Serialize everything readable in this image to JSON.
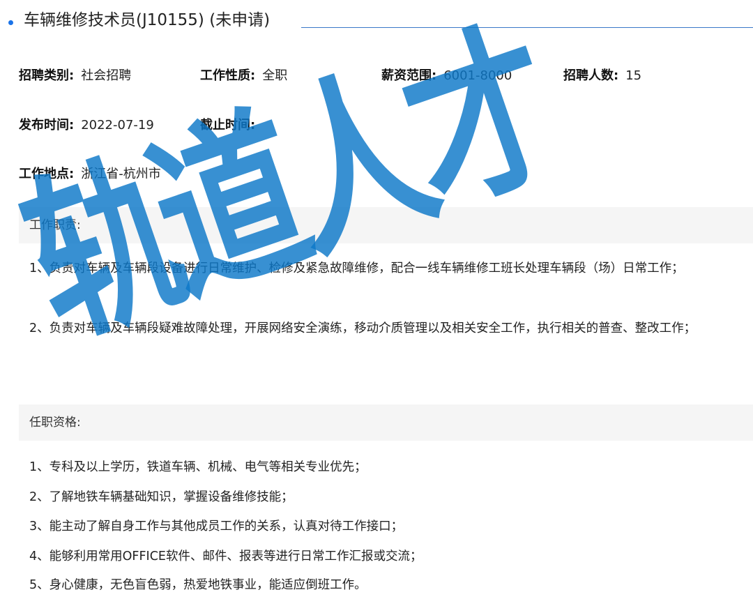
{
  "job": {
    "title": "车辆维修技术员(J10155) (未申请)"
  },
  "fields": {
    "category_label": "招聘类别:",
    "category_value": "社会招聘",
    "nature_label": "工作性质:",
    "nature_value": "全职",
    "salary_label": "薪资范围:",
    "salary_value": "6001-8000",
    "headcount_label": "招聘人数:",
    "headcount_value": "15",
    "publish_label": "发布时间:",
    "publish_value": "2022-07-19",
    "deadline_label": "截止时间:",
    "deadline_value": "",
    "location_label": "工作地点:",
    "location_value": "浙江省-杭州市"
  },
  "duties": {
    "heading": "工作职责:",
    "items": [
      "1、负责对车辆及车辆段设备进行日常维护、检修及紧急故障维修，配合一线车辆维修工班长处理车辆段（场）日常工作；",
      "2、负责对车辆及车辆段疑难故障处理，开展网络安全演练，移动介质管理以及相关安全工作，执行相关的普查、整改工作；"
    ]
  },
  "requirements": {
    "heading": "任职资格:",
    "items": [
      "1、专科及以上学历，铁道车辆、机械、电气等相关专业优先；",
      "2、了解地铁车辆基础知识，掌握设备维修技能；",
      "3、能主动了解自身工作与其他成员工作的关系，认真对待工作接口；",
      "4、能够利用常用OFFICE软件、邮件、报表等进行日常工作汇报或交流；",
      "5、身心健康，无色盲色弱，热爱地铁事业，能适应倒班工作。"
    ]
  },
  "watermark": {
    "text": "轨道人才"
  },
  "colors": {
    "accent": "#1a73e8",
    "watermark": "#0c78c8",
    "section_bg": "#f5f5f5"
  }
}
